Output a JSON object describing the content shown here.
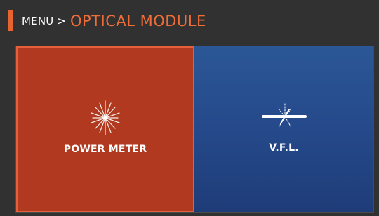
{
  "header": {
    "root_label": "MENU",
    "separator": ">",
    "current_label": "OPTICAL MODULE"
  },
  "tiles": [
    {
      "label": "POWER METER",
      "icon": "power-meter-starburst-icon",
      "color": "#b1391f",
      "selected": true
    },
    {
      "label": "V.F.L.",
      "icon": "visual-fault-locator-icon",
      "color": "#2b5797",
      "selected": false
    }
  ],
  "colors": {
    "background": "#313131",
    "accent": "#e8642e",
    "title": "#ef6d38"
  }
}
